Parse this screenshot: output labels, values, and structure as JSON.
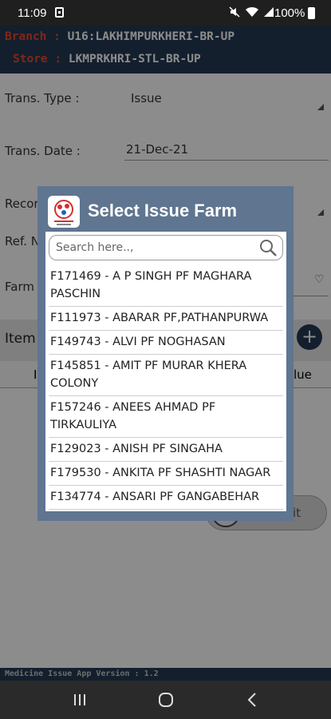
{
  "status_bar": {
    "time": "11:09",
    "battery": "100%"
  },
  "header": {
    "branch_label": "Branch :",
    "branch_value": "U16:LAKHIMPURKHERI-BR-UP",
    "store_label": "Store :",
    "store_value": "LKMPRKHRI-STL-BR-UP"
  },
  "form": {
    "trans_type_label": "Trans. Type :",
    "trans_type_value": "Issue",
    "trans_date_label": "Trans. Date :",
    "trans_date_value": "21-Dec-21",
    "record_label": "Recor",
    "ref_label": "Ref. N",
    "farm_label": "Farm",
    "items_title": "Item",
    "col_left": "I",
    "col_right": "lue",
    "submit_text": "it"
  },
  "footer": {
    "version": "Medicine Issue App Version : 1.2"
  },
  "dialog": {
    "title": "Select Issue Farm",
    "search_placeholder": "Search here..,",
    "items": [
      "F171469 - A P SINGH PF MAGHARA PASCHIN",
      "F111973 - ABARAR PF,PATHANPURWA",
      "F149743 - ALVI PF NOGHASAN",
      "F145851 - AMIT PF MURAR KHERA COLONY",
      "F157246 - ANEES AHMAD PF TIRKAULIYA",
      "F129023 - ANISH PF SINGAHA",
      "F179530 - ANKITA PF SHASHTI NAGAR",
      "F134774 - ANSARI PF GANGABEHAR"
    ]
  },
  "colors": {
    "header_bg": "#243a52",
    "label_red": "#e8472e",
    "dialog_bg": "#5f7590"
  }
}
